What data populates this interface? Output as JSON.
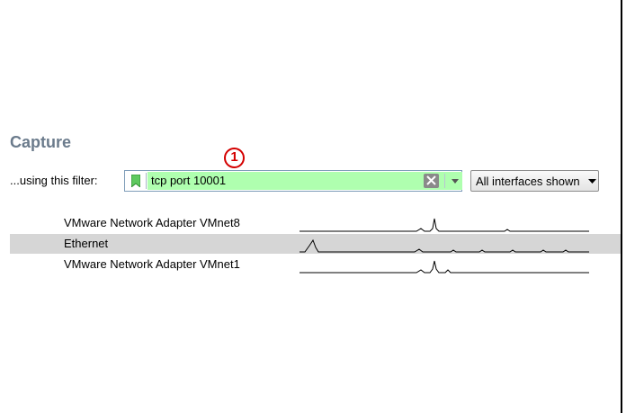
{
  "capture": {
    "title": "Capture",
    "filter_label": "...using this filter:",
    "filter_value": "tcp port 10001",
    "interfaces_button": "All interfaces shown",
    "callout": "1"
  },
  "interfaces": [
    {
      "name": "VMware Network Adapter VMnet8",
      "selected": false
    },
    {
      "name": "Ethernet",
      "selected": true
    },
    {
      "name": "VMware Network Adapter VMnet1",
      "selected": false
    }
  ],
  "colors": {
    "filter_valid_bg": "#afffaf",
    "title": "#6b7b8c",
    "callout": "#d40000",
    "selected_row": "#d6d6d6"
  }
}
